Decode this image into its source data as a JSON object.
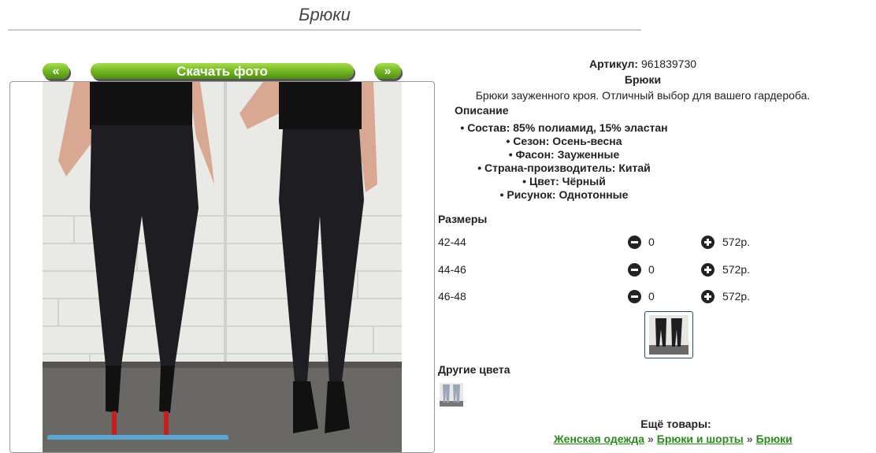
{
  "page": {
    "title": "Брюки"
  },
  "gallery": {
    "prev_label": "«",
    "download_label": "Скачать фото",
    "next_label": "»"
  },
  "product": {
    "sku_label": "Артикул:",
    "sku_value": "961839730",
    "name": "Брюки",
    "short_desc": "Брюки зауженного кроя. Отличный выбор для вашего гардероба.",
    "desc_heading": "Описание",
    "specs": [
      "Состав: 85% полиамид, 15% эластан",
      "Сезон: Осень-весна",
      "Фасон: Зауженные",
      "Страна-производитель: Китай",
      "Цвет: Чёрный",
      "Рисунок: Однотонные"
    ]
  },
  "sizes": {
    "heading": "Размеры",
    "rows": [
      {
        "label": "42-44",
        "qty": "0",
        "price": "572р."
      },
      {
        "label": "44-46",
        "qty": "0",
        "price": "572р."
      },
      {
        "label": "46-48",
        "qty": "0",
        "price": "572р."
      }
    ]
  },
  "other_colors": {
    "heading": "Другие цвета"
  },
  "more": {
    "heading": "Ещё товары:",
    "breadcrumb": [
      "Женская одежда",
      "Брюки и шорты",
      "Брюки"
    ],
    "separator": "»"
  },
  "colors": {
    "accent_green": "#6fb320",
    "link_green": "#2a8a1a"
  }
}
